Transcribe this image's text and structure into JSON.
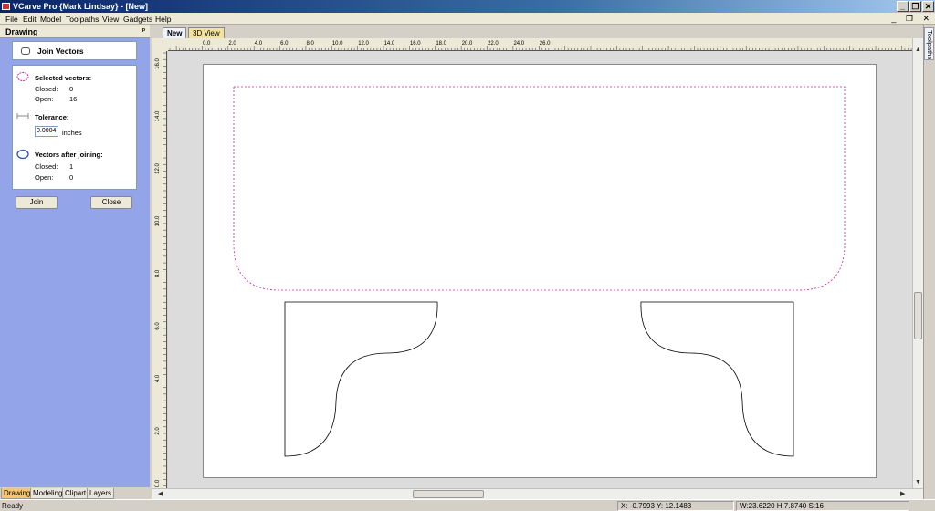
{
  "window": {
    "title": "VCarve Pro {Mark Lindsay} - [New]",
    "buttons": [
      "_",
      "❐",
      "✕"
    ]
  },
  "menu": [
    "File",
    "Edit",
    "Model",
    "Toolpaths",
    "View",
    "Gadgets",
    "Help"
  ],
  "mdi_controls": "_ ❐ ✕",
  "panel": {
    "header": "Drawing",
    "pin": "ᵖ",
    "title": "Join Vectors",
    "selected_heading": "Selected vectors:",
    "closed_label": "Closed:",
    "closed_value": "0",
    "open_label": "Open:",
    "open_value": "16",
    "tolerance_heading": "Tolerance:",
    "tolerance_value": "0.0004",
    "tolerance_units": "inches",
    "after_heading": "Vectors after joining:",
    "after_closed_label": "Closed:",
    "after_closed_value": "1",
    "after_open_label": "Open:",
    "after_open_value": "0",
    "join_button": "Join",
    "close_button": "Close"
  },
  "bottom_tabs": [
    "Drawing",
    "Modeling",
    "Clipart",
    "Layers"
  ],
  "doc_tabs": [
    "New",
    "3D View"
  ],
  "right_tab": "Toolpaths",
  "ruler_h_labels": [
    "0.0",
    "2.0",
    "4.0",
    "6.0",
    "8.0",
    "10.0",
    "12.0",
    "14.0",
    "16.0",
    "18.0",
    "20.0",
    "22.0",
    "24.0",
    "26.0"
  ],
  "ruler_v_labels": [
    "16.0",
    "14.0",
    "12.0",
    "10.0",
    "8.0",
    "6.0",
    "4.0",
    "2.0",
    "0.0"
  ],
  "status": {
    "ready": "Ready",
    "coords": "X: -0.7993 Y: 12.1483",
    "size": "W:23.6220  H:7.8740  S:16"
  },
  "colors": {
    "panel_bg": "#94a4e8",
    "selection": "#cc2299",
    "active_tab": "#f7c56b"
  }
}
